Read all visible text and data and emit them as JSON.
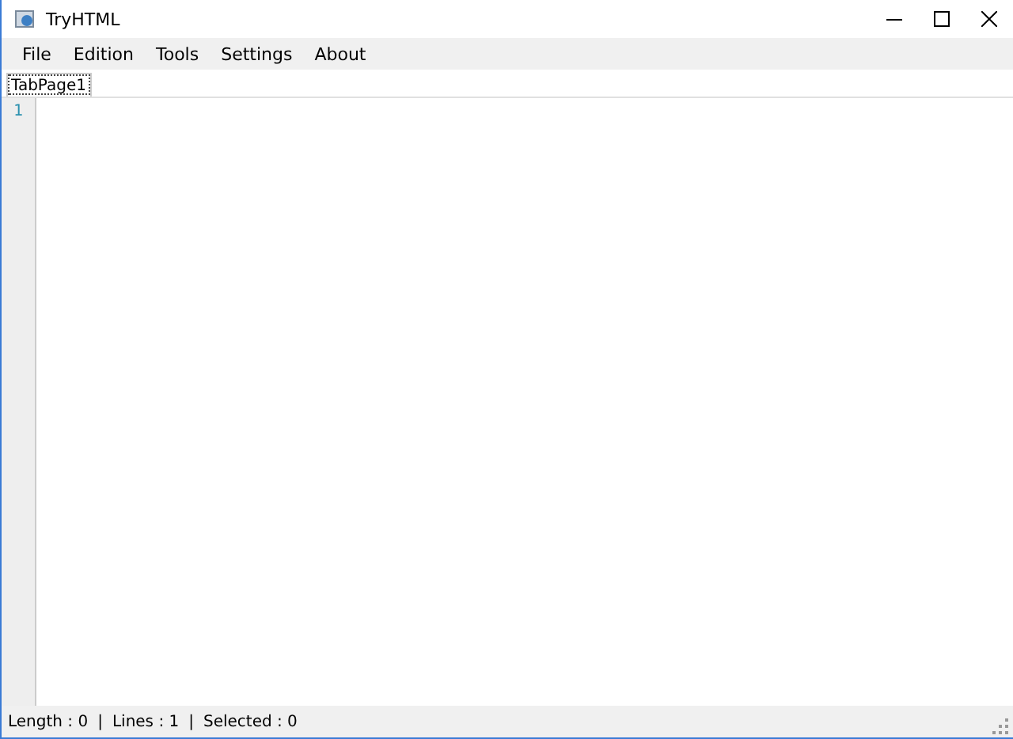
{
  "window": {
    "title": "TryHTML"
  },
  "menu": [
    "File",
    "Edition",
    "Tools",
    "Settings",
    "About"
  ],
  "tabs": [
    {
      "label": "TabPage1",
      "selected": true
    }
  ],
  "editor": {
    "line_numbers": [
      "1"
    ]
  },
  "status_bar": {
    "separator": "|",
    "items": [
      {
        "label": "Length :",
        "value": "0"
      },
      {
        "label": "Lines :",
        "value": "1"
      },
      {
        "label": "Selected :",
        "value": "0"
      }
    ]
  }
}
